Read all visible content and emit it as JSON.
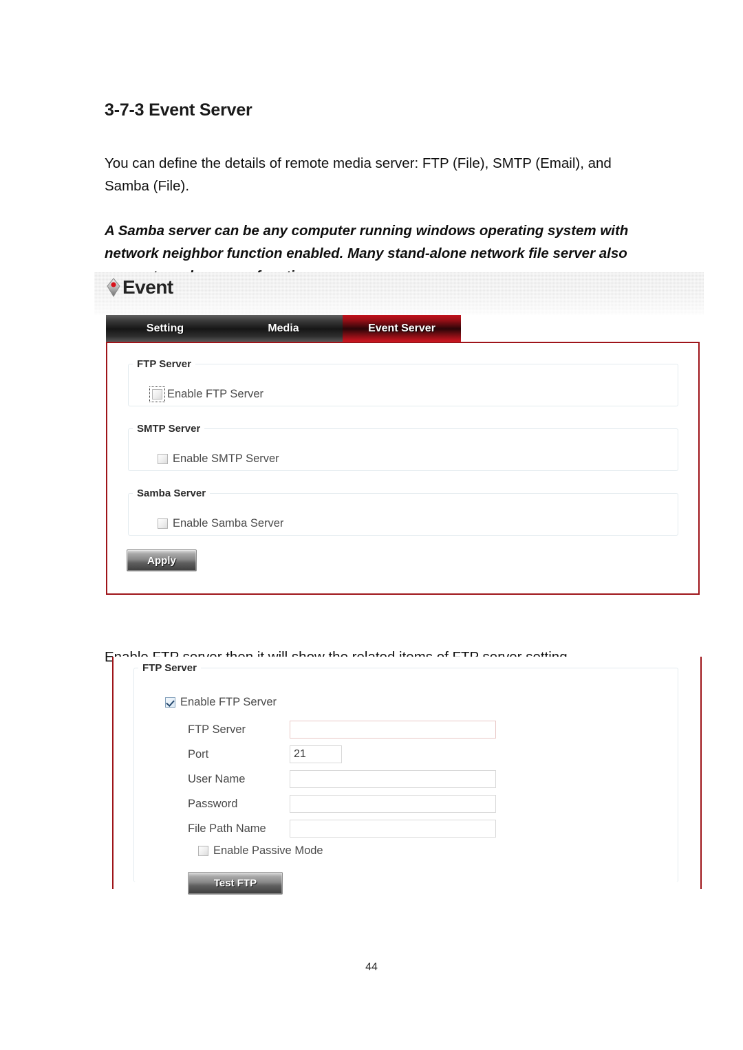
{
  "document": {
    "heading": "3-7-3 Event Server",
    "intro": "You can define the details of remote media server: FTP (File), SMTP (Email), and Samba (File).",
    "note": "A Samba server can be any computer running windows operating system with network neighbor function enabled. Many stand-alone network file server also support samba server function.",
    "caption": "Enable FTP server then it will show the related items of FTP server setting.",
    "page_number": "44"
  },
  "screenshot1": {
    "brand_title": "Event",
    "brand_icon": "diamond-event-icon",
    "tabs": [
      {
        "label": "Setting",
        "active": false
      },
      {
        "label": "Media",
        "active": false
      },
      {
        "label": "Event Server",
        "active": true
      }
    ],
    "groups": [
      {
        "legend": "FTP Server",
        "checkbox_label": "Enable FTP Server",
        "checked": false,
        "focused": true
      },
      {
        "legend": "SMTP Server",
        "checkbox_label": "Enable SMTP Server",
        "checked": false,
        "focused": false
      },
      {
        "legend": "Samba Server",
        "checkbox_label": "Enable Samba Server",
        "checked": false,
        "focused": false
      }
    ],
    "apply_label": "Apply"
  },
  "screenshot2": {
    "legend": "FTP Server",
    "enable_label": "Enable FTP Server",
    "enable_checked": true,
    "fields": [
      {
        "label": "FTP Server",
        "value": "",
        "placeholder": ""
      },
      {
        "label": "Port",
        "value": "21",
        "placeholder": ""
      },
      {
        "label": "User Name",
        "value": "",
        "placeholder": ""
      },
      {
        "label": "Password",
        "value": "",
        "placeholder": ""
      },
      {
        "label": "File Path Name",
        "value": "",
        "placeholder": ""
      }
    ],
    "passive_label": "Enable Passive Mode",
    "passive_checked": false,
    "test_label": "Test FTP"
  },
  "colors": {
    "accent_red": "#9e1419",
    "tab_active_red": "#c4121d",
    "panel_border": "#e2eaee",
    "text": "#4a4a4a"
  }
}
